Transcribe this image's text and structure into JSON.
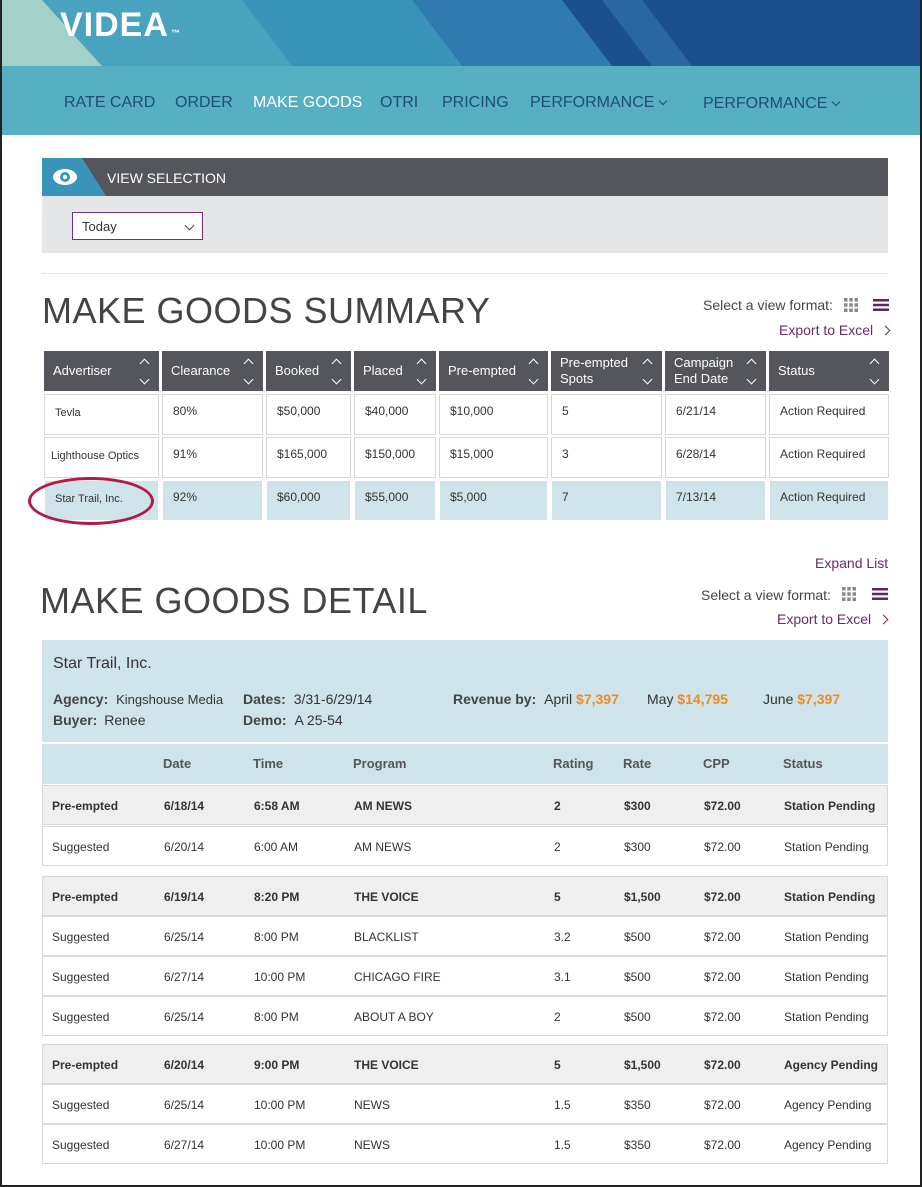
{
  "app": {
    "logo": "VIDEA",
    "logo_mark": "™"
  },
  "nav": {
    "items": [
      "RATE CARD",
      "ORDER",
      "MAKE GOODS",
      "OTRI",
      "PRICING",
      "PERFORMANCE",
      "PERFORMANCE"
    ],
    "active": "MAKE GOODS"
  },
  "view_selection": {
    "title": "VIEW SELECTION",
    "selected": "Today"
  },
  "summary": {
    "title": "MAKE GOODS SUMMARY",
    "view_format_label": "Select a view format:",
    "export_label": "Export to Excel",
    "columns": [
      "Advertiser",
      "Clearance",
      "Booked",
      "Placed",
      "Pre-empted",
      "Pre-empted Spots",
      "Campaign End Date",
      "Status"
    ],
    "rows": [
      [
        "Tevla",
        "80%",
        "$50,000",
        "$40,000",
        "$10,000",
        "5",
        "6/21/14",
        "Action Required"
      ],
      [
        "Lighthouse Optics",
        "91%",
        "$165,000",
        "$150,000",
        "$15,000",
        "3",
        "6/28/14",
        "Action Required"
      ],
      [
        "Star Trail, Inc.",
        "92%",
        "$60,000",
        "$55,000",
        "$5,000",
        "7",
        "7/13/14",
        "Action Required"
      ]
    ],
    "expand_label": "Expand List"
  },
  "detail": {
    "title": "MAKE GOODS DETAIL",
    "view_format_label": "Select a view format:",
    "export_label": "Export to Excel",
    "advertiser": "Star Trail, Inc.",
    "agency_label": "Agency:",
    "agency": "Kingshouse Media",
    "buyer_label": "Buyer:",
    "buyer": "Renee",
    "dates_label": "Dates:",
    "dates": "3/31-6/29/14",
    "demo_label": "Demo:",
    "demo": "A 25-54",
    "revenue_label": "Revenue by:",
    "revenue": [
      {
        "month": "April",
        "amount": "$7,397"
      },
      {
        "month": "May",
        "amount": "$14,795"
      },
      {
        "month": "June",
        "amount": "$7,397"
      }
    ],
    "columns": [
      "Date",
      "Time",
      "Program",
      "Rating",
      "Rate",
      "CPP",
      "Status"
    ],
    "groups": [
      [
        [
          "Pre-empted",
          "6/18/14",
          "6:58 AM",
          "AM NEWS",
          "2",
          "$300",
          "$72.00",
          "Station Pending"
        ],
        [
          "Suggested",
          "6/20/14",
          "6:00 AM",
          "AM NEWS",
          "2",
          "$300",
          "$72.00",
          "Station Pending"
        ]
      ],
      [
        [
          "Pre-empted",
          "6/19/14",
          "8:20 PM",
          "THE VOICE",
          "5",
          "$1,500",
          "$72.00",
          "Station Pending"
        ],
        [
          "Suggested",
          "6/25/14",
          "8:00 PM",
          "BLACKLIST",
          "3.2",
          "$500",
          "$72.00",
          "Station Pending"
        ],
        [
          "Suggested",
          "6/27/14",
          "10:00 PM",
          "CHICAGO FIRE",
          "3.1",
          "$500",
          "$72.00",
          "Station Pending"
        ],
        [
          "Suggested",
          "6/25/14",
          "8:00 PM",
          "ABOUT A BOY",
          "2",
          "$500",
          "$72.00",
          "Station Pending"
        ]
      ],
      [
        [
          "Pre-empted",
          "6/20/14",
          "9:00 PM",
          "THE VOICE",
          "5",
          "$1,500",
          "$72.00",
          "Agency Pending"
        ],
        [
          "Suggested",
          "6/25/14",
          "10:00 PM",
          "NEWS",
          "1.5",
          "$350",
          "$72.00",
          "Agency Pending"
        ],
        [
          "Suggested",
          "6/27/14",
          "10:00 PM",
          "NEWS",
          "1.5",
          "$350",
          "$72.00",
          "Agency Pending"
        ]
      ]
    ]
  },
  "colors": {
    "nav_bg": "#56afc3",
    "dark_bar": "#54565b",
    "highlight_row": "#cfe3ea",
    "accent_orange": "#f28b1e",
    "link_purple": "#6b2a63",
    "annotation_red": "#b01c45"
  }
}
